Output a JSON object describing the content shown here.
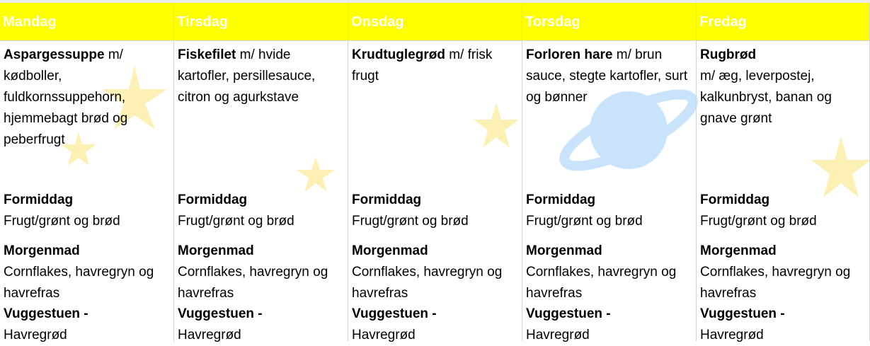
{
  "days": [
    {
      "name": "Mandag",
      "lunch_bold": "Aspargessuppe",
      "lunch_rest": " m/ kødboller, fuldkornssuppehorn, hjemmebagt brød og peberfrugt",
      "formiddag_title": "Formiddag",
      "formiddag_text": "Frugt/grønt og brød",
      "morgenmad_title": "Morgenmad",
      "morgenmad_text": "Cornflakes, havregryn og havrefras",
      "vuggestuen_title": "Vuggestuen -",
      "vuggestuen_text": "Havregrød"
    },
    {
      "name": "Tirsdag",
      "lunch_bold": "Fiskefilet",
      "lunch_rest": " m/ hvide kartofler, persillesauce, citron og agurkstave",
      "formiddag_title": "Formiddag",
      "formiddag_text": "Frugt/grønt og brød",
      "morgenmad_title": "Morgenmad",
      "morgenmad_text": "Cornflakes, havregryn og havrefras",
      "vuggestuen_title": "Vuggestuen -",
      "vuggestuen_text": "Havregrød"
    },
    {
      "name": "Onsdag",
      "lunch_bold": "Krudtuglegrød",
      "lunch_rest": " m/ frisk frugt",
      "formiddag_title": "Formiddag",
      "formiddag_text": "Frugt/grønt og brød",
      "morgenmad_title": "Morgenmad",
      "morgenmad_text": "Cornflakes, havregryn og havrefras",
      "vuggestuen_title": "Vuggestuen -",
      "vuggestuen_text": "Havregrød"
    },
    {
      "name": "Torsdag",
      "lunch_bold": "Forloren hare",
      "lunch_rest": " m/ brun sauce, stegte kartofler, surt og bønner",
      "formiddag_title": "Formiddag",
      "formiddag_text": "Frugt/grønt og brød",
      "morgenmad_title": "Morgenmad",
      "morgenmad_text": "Cornflakes, havregryn og havrefras",
      "vuggestuen_title": "Vuggestuen -",
      "vuggestuen_text": "Havregrød"
    },
    {
      "name": "Fredag",
      "lunch_bold": "Rugbrød",
      "lunch_rest": "m/ æg, leverpostej, kalkunbryst, banan og gnave grønt",
      "formiddag_title": "Formiddag",
      "formiddag_text": "Frugt/grønt og brød",
      "morgenmad_title": "Morgenmad",
      "morgenmad_text": "Cornflakes, havregryn og havrefras",
      "vuggestuen_title": "Vuggestuen -",
      "vuggestuen_text": "Havregrød"
    }
  ],
  "colors": {
    "header_bg": "#ffff00",
    "header_text": "#ffffff",
    "star": "#fdf0b4",
    "planet": "#c9e4fa"
  }
}
